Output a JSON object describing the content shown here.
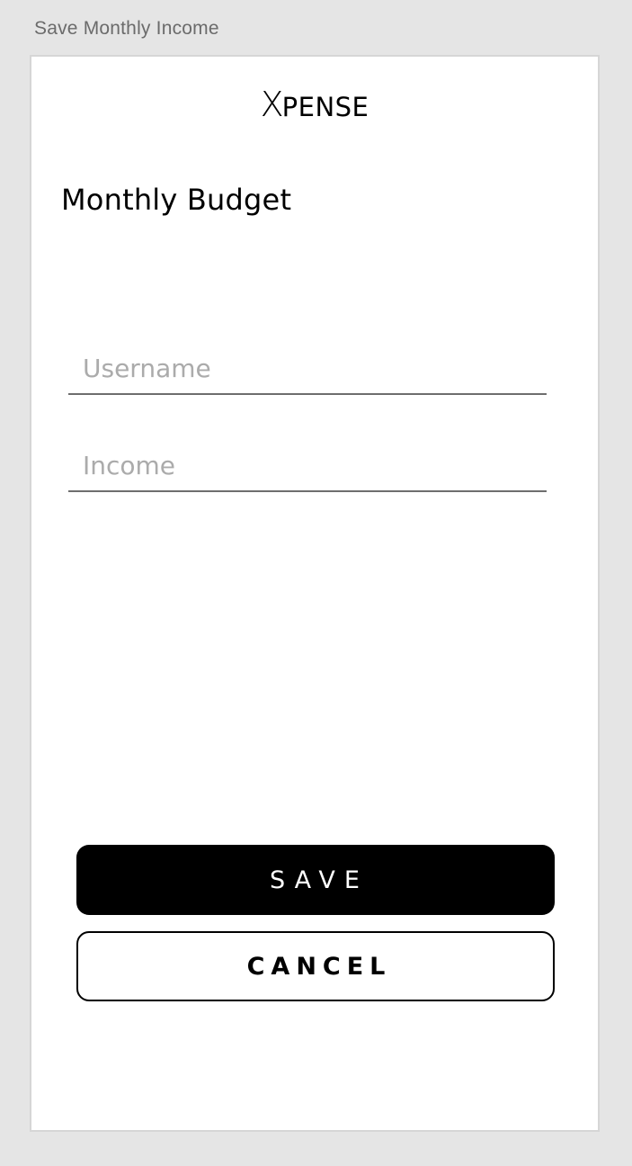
{
  "frame": {
    "title": "Save Monthly Income"
  },
  "app": {
    "logo_initial": "X",
    "logo_rest": "PENSE"
  },
  "page": {
    "heading": "Monthly Budget"
  },
  "form": {
    "username": {
      "placeholder": "Username",
      "value": ""
    },
    "income": {
      "placeholder": "Income",
      "value": ""
    }
  },
  "actions": {
    "save_label": "SAVE",
    "cancel_label": "CANCEL"
  },
  "colors": {
    "background": "#e5e5e5",
    "surface": "#ffffff",
    "primary": "#000000",
    "placeholder": "#ababab"
  }
}
